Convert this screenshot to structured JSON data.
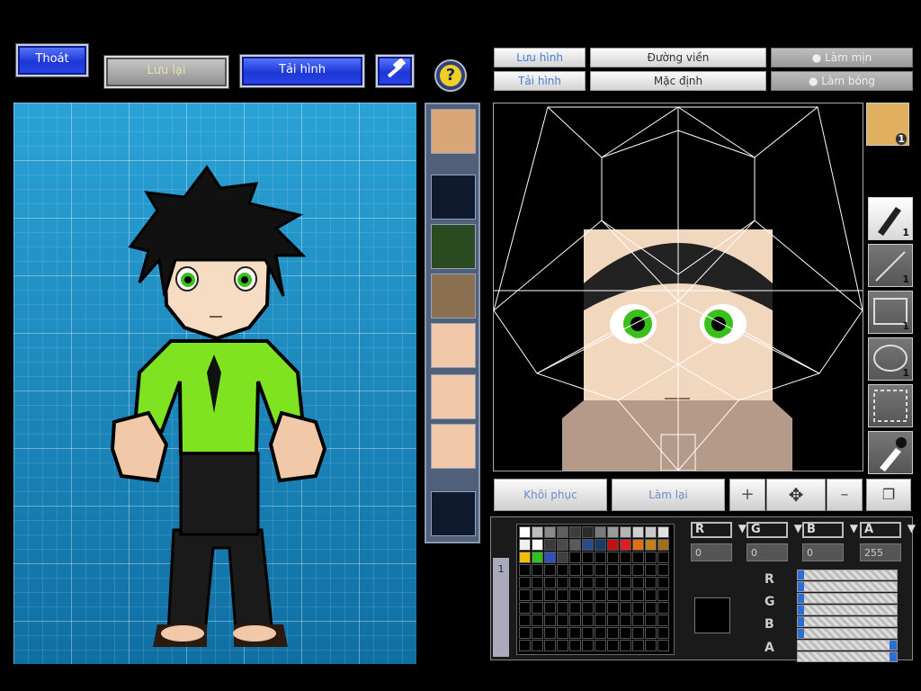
{
  "top_buttons": {
    "exit": "Thoát",
    "save": "Lưu lại",
    "reload": "Tải hình",
    "hammer_icon": "hammer-icon",
    "help_icon": "question-icon"
  },
  "editor_toolbar": {
    "save_image": "Lưu hình",
    "outline": "Đường viền",
    "smooth": "Làm mịn",
    "load_image": "Tải hình",
    "default": "Mặc định",
    "shade": "Làm bóng"
  },
  "face_badge_count": "1",
  "tools": [
    {
      "icon": "pen-icon",
      "count": "1"
    },
    {
      "icon": "line-icon",
      "count": "1"
    },
    {
      "icon": "rectangle-icon",
      "count": "1"
    },
    {
      "icon": "ellipse-icon",
      "count": "1"
    },
    {
      "icon": "selection-icon",
      "count": ""
    },
    {
      "icon": "eyedropper-icon",
      "count": ""
    }
  ],
  "bottom_bar": {
    "restore": "Khôi phục",
    "redo": "Làm lại"
  },
  "color": {
    "channels": [
      "R",
      "G",
      "B",
      "A"
    ],
    "values": [
      "0",
      "0",
      "0",
      "255"
    ],
    "slider_levels": [
      0.02,
      0.02,
      0.02,
      1.0
    ]
  },
  "layer_tab": "1",
  "palette_colors": [
    "#ffffff",
    "#bdbdbd",
    "#8a8a8a",
    "#5e5e5e",
    "#3d3d3d",
    "#2a2a2a",
    "#7a7a7a",
    "#9a9a9a",
    "#b5b5b5",
    "#cfcfcf",
    "#c8c8c8",
    "#e0e0e0",
    "#f0f0f0",
    "#ffffff",
    "#3a3a3a",
    "#4a4a4a",
    "#5a5a5a",
    "#2a4a8a",
    "#1a3a6a",
    "#c01010",
    "#e02020",
    "#e07010",
    "#c08020",
    "#a07020",
    "#f0c000",
    "#30c020",
    "#3050c0",
    "#404040"
  ]
}
